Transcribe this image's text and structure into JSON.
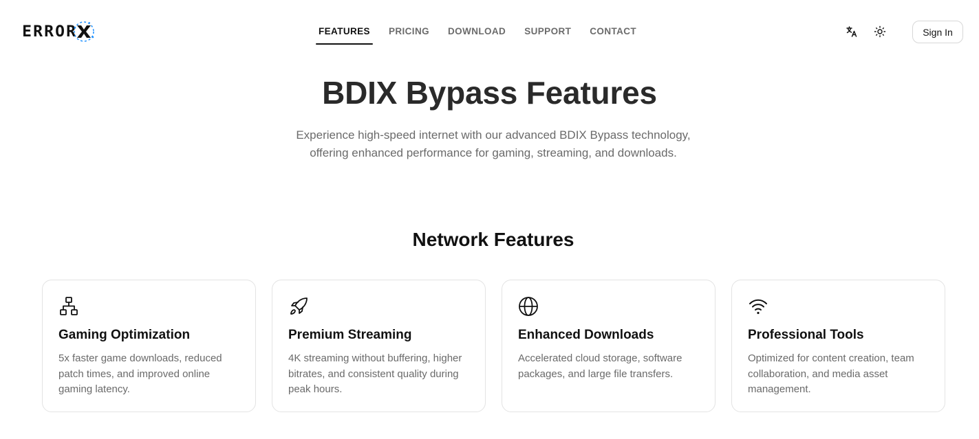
{
  "brand": {
    "logo_text": "ERROR",
    "accent": "#1e90ff"
  },
  "nav": {
    "items": [
      {
        "label": "FEATURES",
        "active": true
      },
      {
        "label": "PRICING",
        "active": false
      },
      {
        "label": "DOWNLOAD",
        "active": false
      },
      {
        "label": "SUPPORT",
        "active": false
      },
      {
        "label": "CONTACT",
        "active": false
      }
    ]
  },
  "header": {
    "translate_icon": "translate-icon",
    "theme_icon": "sun-icon",
    "signin_label": "Sign In"
  },
  "hero": {
    "title": "BDIX Bypass Features",
    "subtitle": "Experience high-speed internet with our advanced BDIX Bypass technology, offering enhanced performance for gaming, streaming, and downloads."
  },
  "section": {
    "title": "Network Features"
  },
  "cards": [
    {
      "icon": "network-icon",
      "title": "Gaming Optimization",
      "desc": "5x faster game downloads, reduced patch times, and improved online gaming latency."
    },
    {
      "icon": "rocket-icon",
      "title": "Premium Streaming",
      "desc": "4K streaming without buffering, higher bitrates, and consistent quality during peak hours."
    },
    {
      "icon": "globe-icon",
      "title": "Enhanced Downloads",
      "desc": "Accelerated cloud storage, software packages, and large file transfers."
    },
    {
      "icon": "wifi-icon",
      "title": "Professional Tools",
      "desc": "Optimized for content creation, team collaboration, and media asset management."
    }
  ]
}
